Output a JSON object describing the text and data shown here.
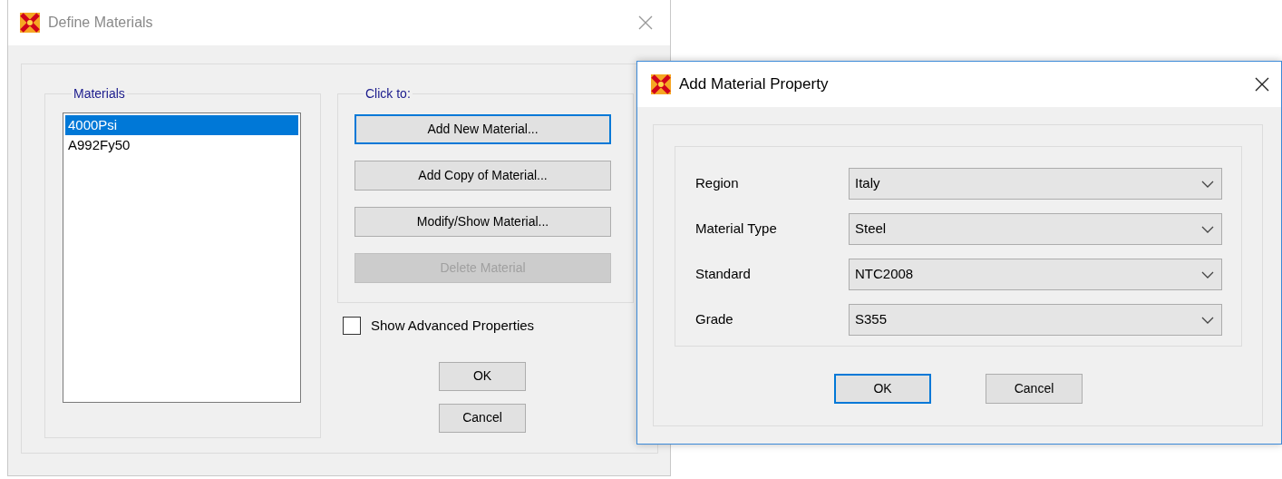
{
  "define_window": {
    "title": "Define Materials",
    "materials_group": {
      "label": "Materials",
      "items": [
        {
          "text": "4000Psi",
          "selected": true
        },
        {
          "text": "A992Fy50",
          "selected": false
        }
      ]
    },
    "actions_group": {
      "label": "Click to:",
      "buttons": [
        {
          "label": "Add New Material...",
          "focused": true,
          "disabled": false
        },
        {
          "label": "Add Copy of Material...",
          "focused": false,
          "disabled": false
        },
        {
          "label": "Modify/Show Material...",
          "focused": false,
          "disabled": false
        },
        {
          "label": "Delete Material",
          "focused": false,
          "disabled": true
        }
      ]
    },
    "show_advanced": {
      "label": "Show Advanced Properties",
      "checked": false
    },
    "buttons": [
      {
        "label": "OK",
        "focused": false
      },
      {
        "label": "Cancel",
        "focused": false
      }
    ]
  },
  "add_window": {
    "title": "Add Material Property",
    "fields": [
      {
        "label": "Region",
        "value": "Italy"
      },
      {
        "label": "Material Type",
        "value": "Steel"
      },
      {
        "label": "Standard",
        "value": "NTC2008"
      },
      {
        "label": "Grade",
        "value": "S355"
      }
    ],
    "buttons": [
      {
        "label": "OK",
        "focused": true
      },
      {
        "label": "Cancel",
        "focused": false
      }
    ]
  }
}
